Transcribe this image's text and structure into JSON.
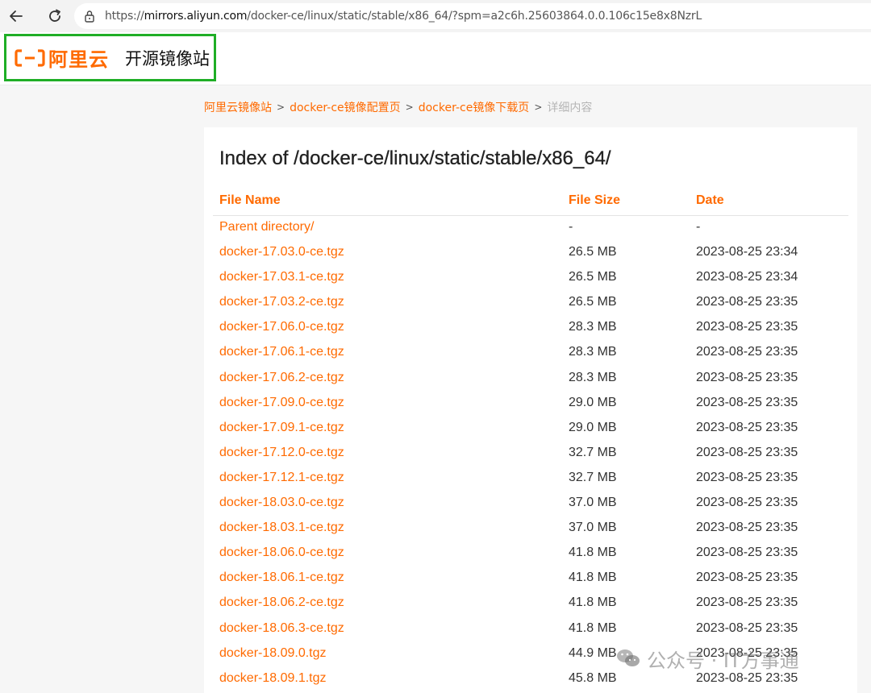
{
  "browser": {
    "back_icon": "arrow-left-icon",
    "reload_icon": "reload-icon",
    "lock_icon": "lock-icon",
    "url_prefix": "https://",
    "url_host": "mirrors.aliyun.com",
    "url_path": "/docker-ce/linux/static/stable/x86_64/?spm=a2c6h.25603864.0.0.106c15e8x8NzrL"
  },
  "header": {
    "logo_text": "阿里云",
    "site_name": "开源镜像站",
    "brand_color": "#ff6a00",
    "highlight_color": "#1fae26"
  },
  "breadcrumb": {
    "items": [
      "阿里云镜像站",
      "docker-ce镜像配置页",
      "docker-ce镜像下载页"
    ],
    "current": "详细内容",
    "separator": ">"
  },
  "listing": {
    "title": "Index of /docker-ce/linux/static/stable/x86_64/",
    "columns": [
      "File Name",
      "File Size",
      "Date"
    ],
    "rows": [
      {
        "name": "Parent directory/",
        "size": "-",
        "date": "-"
      },
      {
        "name": "docker-17.03.0-ce.tgz",
        "size": "26.5 MB",
        "date": "2023-08-25 23:34"
      },
      {
        "name": "docker-17.03.1-ce.tgz",
        "size": "26.5 MB",
        "date": "2023-08-25 23:34"
      },
      {
        "name": "docker-17.03.2-ce.tgz",
        "size": "26.5 MB",
        "date": "2023-08-25 23:35"
      },
      {
        "name": "docker-17.06.0-ce.tgz",
        "size": "28.3 MB",
        "date": "2023-08-25 23:35"
      },
      {
        "name": "docker-17.06.1-ce.tgz",
        "size": "28.3 MB",
        "date": "2023-08-25 23:35"
      },
      {
        "name": "docker-17.06.2-ce.tgz",
        "size": "28.3 MB",
        "date": "2023-08-25 23:35"
      },
      {
        "name": "docker-17.09.0-ce.tgz",
        "size": "29.0 MB",
        "date": "2023-08-25 23:35"
      },
      {
        "name": "docker-17.09.1-ce.tgz",
        "size": "29.0 MB",
        "date": "2023-08-25 23:35"
      },
      {
        "name": "docker-17.12.0-ce.tgz",
        "size": "32.7 MB",
        "date": "2023-08-25 23:35"
      },
      {
        "name": "docker-17.12.1-ce.tgz",
        "size": "32.7 MB",
        "date": "2023-08-25 23:35"
      },
      {
        "name": "docker-18.03.0-ce.tgz",
        "size": "37.0 MB",
        "date": "2023-08-25 23:35"
      },
      {
        "name": "docker-18.03.1-ce.tgz",
        "size": "37.0 MB",
        "date": "2023-08-25 23:35"
      },
      {
        "name": "docker-18.06.0-ce.tgz",
        "size": "41.8 MB",
        "date": "2023-08-25 23:35"
      },
      {
        "name": "docker-18.06.1-ce.tgz",
        "size": "41.8 MB",
        "date": "2023-08-25 23:35"
      },
      {
        "name": "docker-18.06.2-ce.tgz",
        "size": "41.8 MB",
        "date": "2023-08-25 23:35"
      },
      {
        "name": "docker-18.06.3-ce.tgz",
        "size": "41.8 MB",
        "date": "2023-08-25 23:35"
      },
      {
        "name": "docker-18.09.0.tgz",
        "size": "44.9 MB",
        "date": "2023-08-25 23:35"
      },
      {
        "name": "docker-18.09.1.tgz",
        "size": "45.8 MB",
        "date": "2023-08-25 23:35"
      }
    ]
  },
  "watermark": {
    "text": "公众号 · IT方事通",
    "icon": "wechat-icon"
  }
}
